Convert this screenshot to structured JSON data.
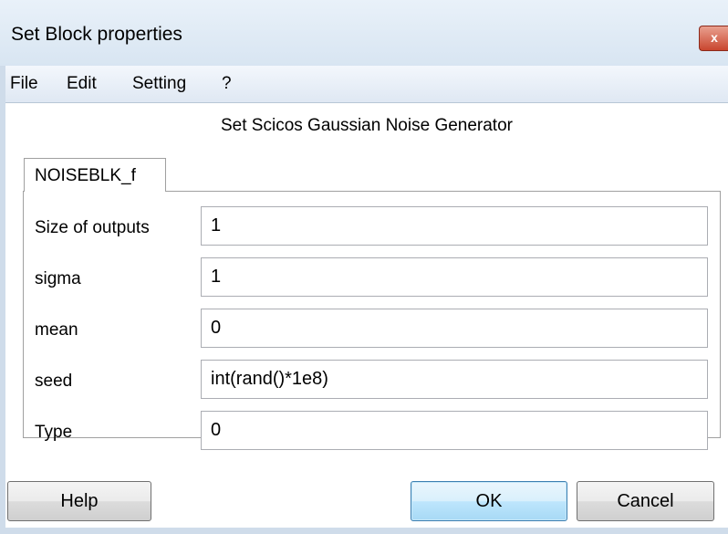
{
  "window": {
    "title": "Set Block properties",
    "close_glyph": "x"
  },
  "menu": {
    "items": [
      "File",
      "Edit",
      "Setting",
      "?"
    ]
  },
  "header": {
    "title": "Set Scicos Gaussian Noise Generator"
  },
  "tabs": [
    {
      "label": "NOISEBLK_f",
      "selected": true
    }
  ],
  "fields": [
    {
      "label": "Size of outputs",
      "value": "1"
    },
    {
      "label": "sigma",
      "value": "1"
    },
    {
      "label": "mean",
      "value": "0"
    },
    {
      "label": "seed",
      "value": "int(rand()*1e8)"
    },
    {
      "label": "Type",
      "value": "0"
    }
  ],
  "buttons": {
    "help": "Help",
    "ok": "OK",
    "cancel": "Cancel"
  },
  "colors": {
    "titlebar": "#dfe9f5",
    "close_button": "#c9462f",
    "ok_button_border": "#3c7fb1"
  }
}
